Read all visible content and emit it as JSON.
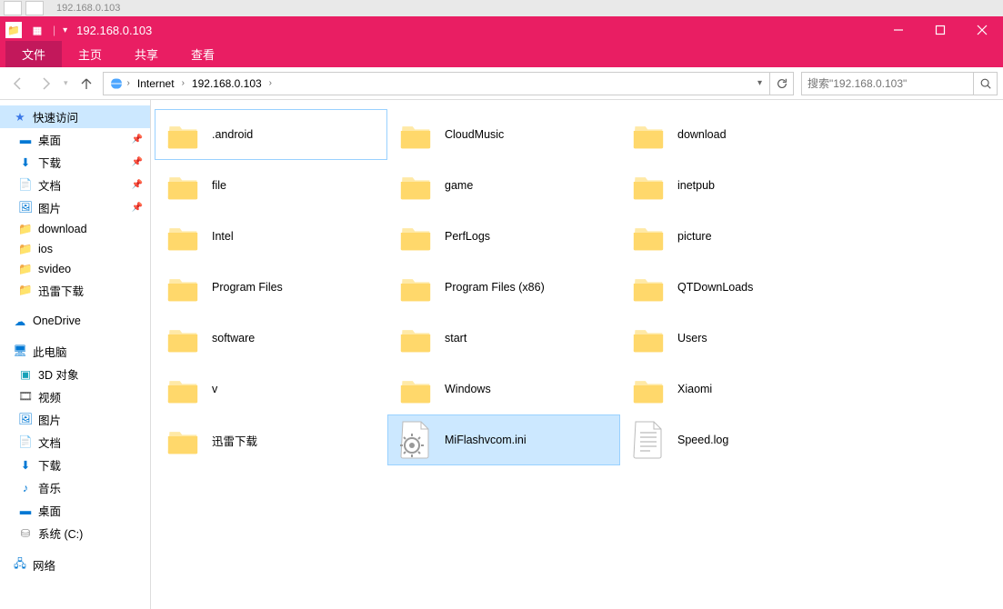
{
  "remnant_title": "192.168.0.103",
  "window_title": "192.168.0.103",
  "ribbon": {
    "file": "文件",
    "home": "主页",
    "share": "共享",
    "view": "查看"
  },
  "breadcrumbs": [
    "Internet",
    "192.168.0.103"
  ],
  "refresh_drop": "▾",
  "search_placeholder": "搜索\"192.168.0.103\"",
  "sidebar": {
    "quick": {
      "label": "快速访问",
      "items": [
        {
          "label": "桌面",
          "icon": "desktop",
          "pinned": true
        },
        {
          "label": "下载",
          "icon": "download",
          "pinned": true
        },
        {
          "label": "文档",
          "icon": "docs",
          "pinned": true
        },
        {
          "label": "图片",
          "icon": "pics",
          "pinned": true
        },
        {
          "label": "download",
          "icon": "folder",
          "pinned": false
        },
        {
          "label": "ios",
          "icon": "folder",
          "pinned": false
        },
        {
          "label": "svideo",
          "icon": "folder",
          "pinned": false
        },
        {
          "label": "迅雷下载",
          "icon": "folder",
          "pinned": false
        }
      ]
    },
    "onedrive": {
      "label": "OneDrive"
    },
    "thispc": {
      "label": "此电脑",
      "items": [
        {
          "label": "3D 对象",
          "icon": "3d"
        },
        {
          "label": "视频",
          "icon": "video"
        },
        {
          "label": "图片",
          "icon": "pics"
        },
        {
          "label": "文档",
          "icon": "docs"
        },
        {
          "label": "下载",
          "icon": "download"
        },
        {
          "label": "音乐",
          "icon": "music"
        },
        {
          "label": "桌面",
          "icon": "desktop"
        },
        {
          "label": "系统 (C:)",
          "icon": "disk"
        }
      ]
    },
    "network": {
      "label": "网络"
    }
  },
  "items": [
    {
      "label": ".android",
      "type": "folder",
      "state": "outlined"
    },
    {
      "label": "CloudMusic",
      "type": "folder"
    },
    {
      "label": "download",
      "type": "folder"
    },
    {
      "label": "file",
      "type": "folder"
    },
    {
      "label": "game",
      "type": "folder"
    },
    {
      "label": "inetpub",
      "type": "folder"
    },
    {
      "label": "Intel",
      "type": "folder"
    },
    {
      "label": "PerfLogs",
      "type": "folder"
    },
    {
      "label": "picture",
      "type": "folder"
    },
    {
      "label": "Program Files",
      "type": "folder"
    },
    {
      "label": "Program Files (x86)",
      "type": "folder"
    },
    {
      "label": "QTDownLoads",
      "type": "folder"
    },
    {
      "label": "software",
      "type": "folder"
    },
    {
      "label": "start",
      "type": "folder"
    },
    {
      "label": "Users",
      "type": "folder"
    },
    {
      "label": "v",
      "type": "folder"
    },
    {
      "label": "Windows",
      "type": "folder"
    },
    {
      "label": "Xiaomi",
      "type": "folder"
    },
    {
      "label": "迅雷下载",
      "type": "folder"
    },
    {
      "label": "MiFlashvcom.ini",
      "type": "ini",
      "state": "sel"
    },
    {
      "label": "Speed.log",
      "type": "log"
    }
  ]
}
